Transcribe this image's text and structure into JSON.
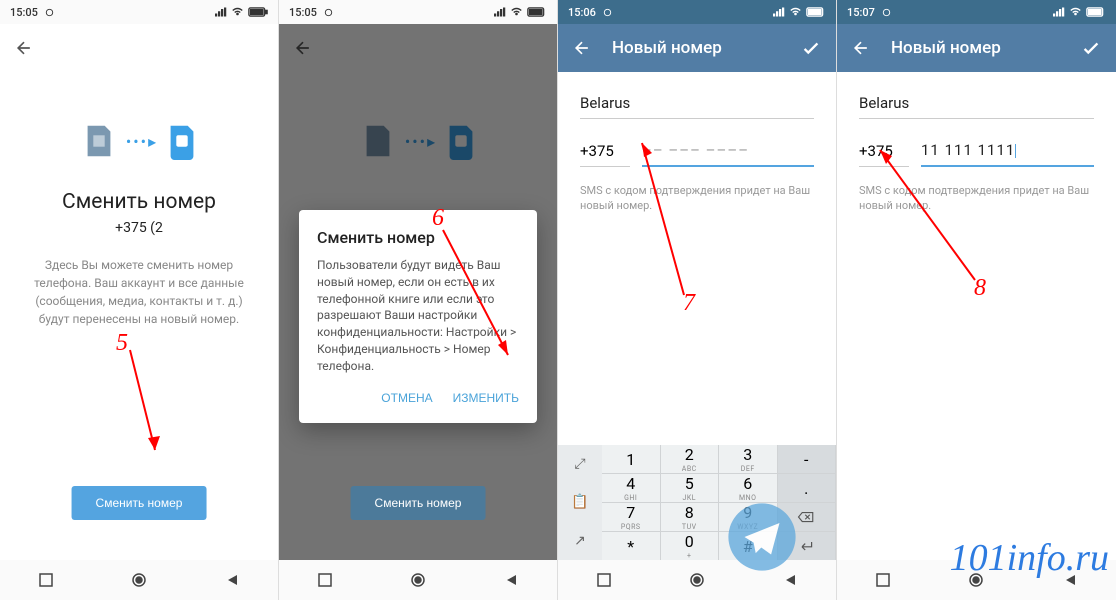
{
  "status": {
    "time1": "15:05",
    "time2": "15:05",
    "time3": "15:06",
    "time4": "15:07"
  },
  "screen1": {
    "title": "Сменить номер",
    "subtitle": "+375 (2",
    "description": "Здесь Вы можете сменить номер телефона. Ваш аккаунт и все данные (сообщения, медиа, контакты и т. д.) будут перенесены на новый номер.",
    "button": "Сменить номер"
  },
  "screen2": {
    "button": "Сменить номер",
    "dialog": {
      "title": "Сменить номер",
      "body": "Пользователи будут видеть Ваш новый номер, если он есть в их телефонной книге или если это разрешают Ваши настройки конфиденциальности: Настройки > Конфиденциальность > Номер телефона.",
      "cancel": "ОТМЕНА",
      "confirm": "ИЗМЕНИТЬ"
    }
  },
  "screen3": {
    "title": "Новый номер",
    "country": "Belarus",
    "code": "+375",
    "placeholder": "–– ––– ––––",
    "sms": "SMS с кодом подтверждения придет на Ваш новый номер."
  },
  "screen4": {
    "title": "Новый номер",
    "country": "Belarus",
    "code": "+375",
    "value": "11 111 1111",
    "sms": "SMS с кодом подтверждения придет на Ваш новый номер."
  },
  "keypad": {
    "k1": "1",
    "k2": "2",
    "k2s": "ABC",
    "k3": "3",
    "k3s": "DEF",
    "k4": "4",
    "k4s": "GHI",
    "k5": "5",
    "k5s": "JKL",
    "k6": "6",
    "k6s": "MNO",
    "k7": "7",
    "k7s": "PQRS",
    "k8": "8",
    "k8s": "TUV",
    "k9": "9",
    "k9s": "WXYZ",
    "star": "*",
    "k0": "0",
    "k0s": "+",
    "hash": "#",
    "minus": "-",
    "dot": ".",
    "comma": ","
  },
  "labels": {
    "l5": "5",
    "l6": "6",
    "l7": "7",
    "l8": "8"
  },
  "watermark": "101info.ru"
}
